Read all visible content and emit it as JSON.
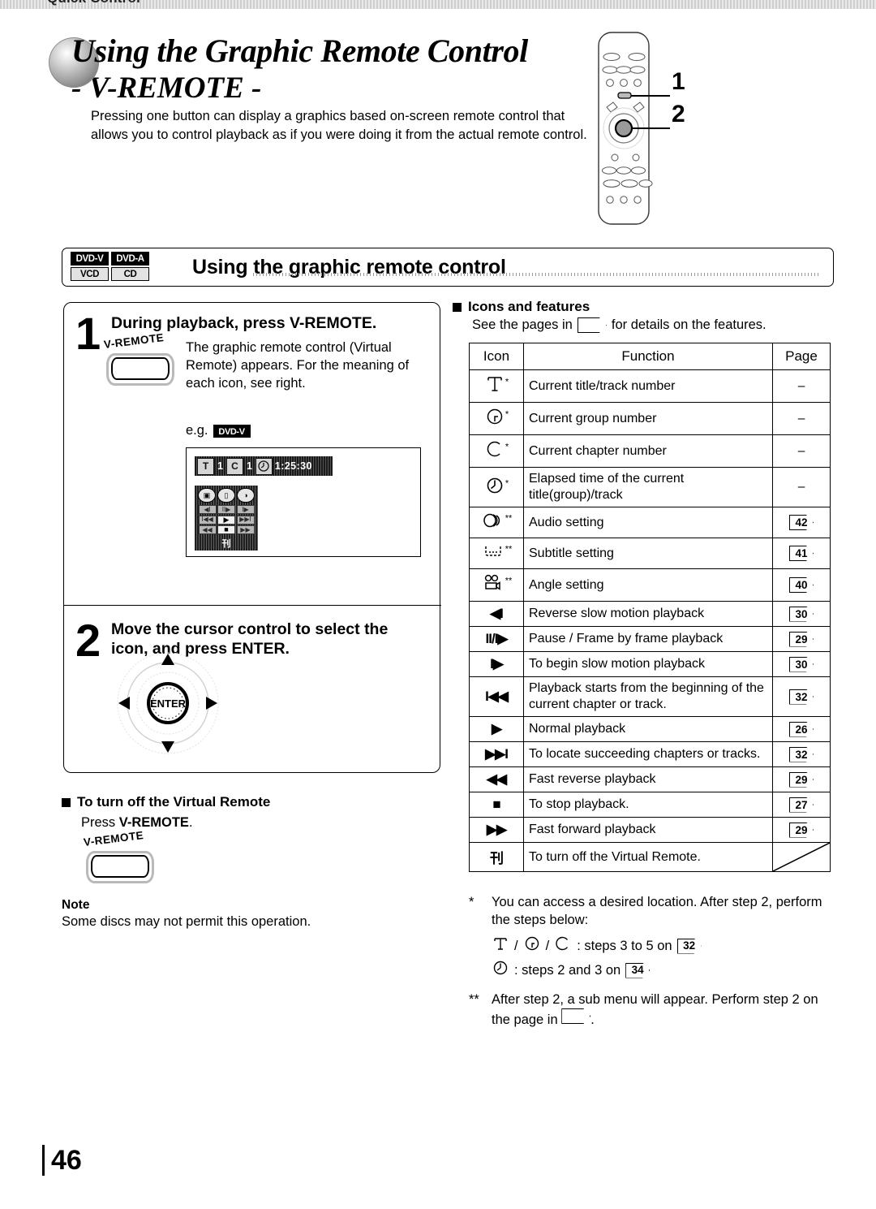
{
  "tab_header": {
    "label": "Quick Control"
  },
  "title": {
    "line1": "Using the Graphic Remote Control",
    "line2": "- V-REMOTE -",
    "lead": "Pressing one button can display a graphics based on-screen remote control that allows you to control playback as if you were doing it from the actual remote control."
  },
  "remote_callouts": {
    "one": "1",
    "two": "2"
  },
  "section": {
    "title": "Using the graphic remote control",
    "badges": [
      {
        "label": "DVD-V",
        "style": "dark"
      },
      {
        "label": "DVD-A",
        "style": "dark"
      },
      {
        "label": "VCD",
        "style": "light"
      },
      {
        "label": "CD",
        "style": "light"
      }
    ]
  },
  "steps": [
    {
      "number": "1",
      "heading": "During playback, press V-REMOTE.",
      "button_label": "V-REMOTE",
      "body": "The graphic remote control (Virtual Remote) appears. For the meaning of each icon, see right.",
      "eg_label": "e.g.",
      "eg_badge": "DVD-V"
    },
    {
      "number": "2",
      "heading": "Move the cursor control to select the icon, and press ENTER.",
      "enter_label": "ENTER"
    }
  ],
  "osd": {
    "status": {
      "title_icon": "T",
      "title_value": "1",
      "chapter_icon": "C",
      "chapter_value": "1",
      "time_icon": "clock-icon",
      "time_value": "1:25:30"
    },
    "top_icons": [
      "angle-icon",
      "subtitle-icon",
      "audio-icon"
    ],
    "grid": [
      "reverse-slow-icon",
      "pause-frame-icon",
      "slow-forward-icon",
      "previous-icon",
      "play-icon",
      "next-icon",
      "fast-reverse-icon",
      "stop-icon",
      "fast-forward-icon"
    ],
    "grid_glyphs": [
      "◀I",
      "II/▶",
      "I▶",
      "◀◀",
      "▶",
      "▶▶I",
      "◀◀",
      "■",
      "▶▶"
    ],
    "exit_glyph": "刊",
    "exit_icon": "exit-virtual-remote-icon"
  },
  "turn_off": {
    "heading": "To turn off the Virtual Remote",
    "press_prefix": "Press ",
    "press_button": "V-REMOTE",
    "press_suffix": ".",
    "button_label": "V-REMOTE"
  },
  "note": {
    "heading": "Note",
    "body": "Some discs may not permit this operation."
  },
  "icons_features": {
    "heading": "Icons and features",
    "see_prefix": "See the pages in",
    "see_suffix": "for details on the features.",
    "columns": [
      "Icon",
      "Function",
      "Page"
    ],
    "rows": [
      {
        "icon": "T",
        "icon_name": "title-track-icon",
        "stars": "*",
        "function": "Current title/track number",
        "page": "–",
        "page_tag": false
      },
      {
        "icon": "G",
        "icon_name": "group-icon",
        "stars": "*",
        "function": "Current group number",
        "page": "–",
        "page_tag": false
      },
      {
        "icon": "C",
        "icon_name": "chapter-icon",
        "stars": "*",
        "function": "Current chapter number",
        "page": "–",
        "page_tag": false
      },
      {
        "icon": "clock",
        "icon_name": "elapsed-time-icon",
        "stars": "*",
        "function": "Elapsed time of the current title(group)/track",
        "page": "–",
        "page_tag": false
      },
      {
        "icon": "audio",
        "icon_name": "audio-setting-icon",
        "stars": "**",
        "function": "Audio setting",
        "page": "42",
        "page_tag": true
      },
      {
        "icon": "subtitle",
        "icon_name": "subtitle-setting-icon",
        "stars": "**",
        "function": "Subtitle setting",
        "page": "41",
        "page_tag": true
      },
      {
        "icon": "angle",
        "icon_name": "angle-setting-icon",
        "stars": "**",
        "function": "Angle setting",
        "page": "40",
        "page_tag": true
      },
      {
        "icon": "◀I",
        "icon_name": "reverse-slow-icon",
        "stars": "",
        "function": "Reverse slow motion playback",
        "page": "30",
        "page_tag": true
      },
      {
        "icon": "II/I▶",
        "icon_name": "pause-frame-icon",
        "stars": "",
        "function": "Pause / Frame by frame playback",
        "page": "29",
        "page_tag": true
      },
      {
        "icon": "I▶",
        "icon_name": "slow-motion-icon",
        "stars": "",
        "function": "To begin slow motion playback",
        "page": "30",
        "page_tag": true
      },
      {
        "icon": "I◀◀",
        "icon_name": "previous-chapter-icon",
        "stars": "",
        "function": "Playback starts from the beginning of the current chapter or track.",
        "page": "32",
        "page_tag": true
      },
      {
        "icon": "▶",
        "icon_name": "play-icon",
        "stars": "",
        "function": "Normal playback",
        "page": "26",
        "page_tag": true
      },
      {
        "icon": "▶▶I",
        "icon_name": "next-chapter-icon",
        "stars": "",
        "function": "To locate succeeding chapters or tracks.",
        "page": "32",
        "page_tag": true
      },
      {
        "icon": "◀◀",
        "icon_name": "fast-reverse-icon",
        "stars": "",
        "function": "Fast reverse playback",
        "page": "29",
        "page_tag": true
      },
      {
        "icon": "■",
        "icon_name": "stop-icon",
        "stars": "",
        "function": "To stop playback.",
        "page": "27",
        "page_tag": true
      },
      {
        "icon": "▶▶",
        "icon_name": "fast-forward-icon",
        "stars": "",
        "function": "Fast forward playback",
        "page": "29",
        "page_tag": true
      },
      {
        "icon": "刊",
        "icon_name": "exit-virtual-remote-icon",
        "stars": "",
        "function": "To turn off the Virtual Remote.",
        "page": "",
        "page_tag": false
      }
    ]
  },
  "footnotes": {
    "single_mark": "*",
    "single_text": "You can access a desired location. After step 2, perform the steps below:",
    "line_a_suffix": ": steps 3 to 5 on",
    "line_a_page": "32",
    "line_b_suffix": ": steps 2 and 3 on",
    "line_b_page": "34",
    "double_mark": "**",
    "double_text": "After step 2, a sub menu will appear. Perform step 2 on the page in",
    "double_tail": "."
  },
  "page_number": "46"
}
